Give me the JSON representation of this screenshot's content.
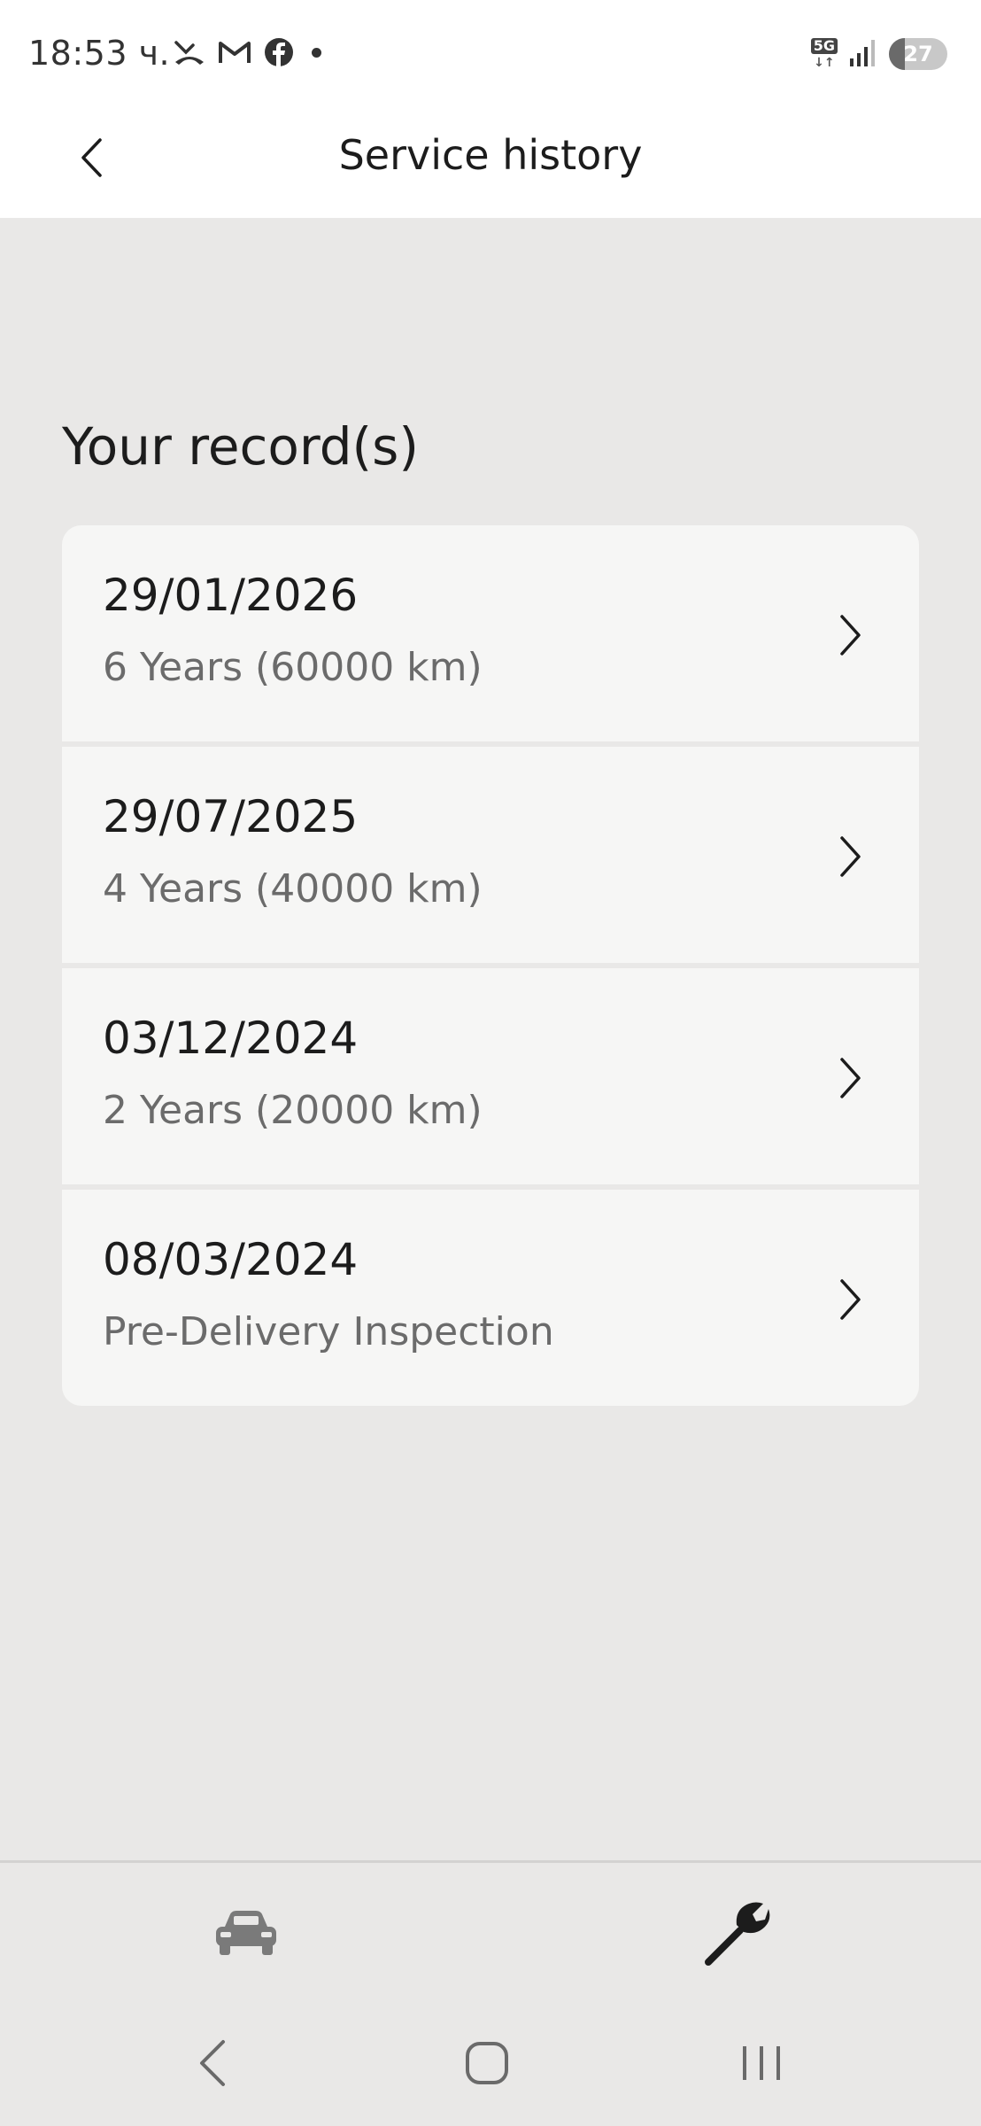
{
  "status_bar": {
    "time": "18:53 ч.",
    "network": "5G",
    "battery_level": "27",
    "battery_fraction": 0.27,
    "icons_left": [
      "missed-call-icon",
      "gmail-icon",
      "facebook-icon",
      "notification-dot"
    ],
    "icons_right": [
      "network-5g-icon",
      "signal-icon",
      "battery-icon"
    ]
  },
  "header": {
    "title": "Service history",
    "back_icon": "chevron-left-icon"
  },
  "section": {
    "title": "Your record(s)"
  },
  "records": [
    {
      "date": "29/01/2026",
      "description": "6 Years (60000 km)"
    },
    {
      "date": "29/07/2025",
      "description": "4 Years (40000 km)"
    },
    {
      "date": "03/12/2024",
      "description": "2 Years (20000 km)"
    },
    {
      "date": "08/03/2024",
      "description": "Pre-Delivery Inspection"
    }
  ],
  "bottom_nav": {
    "tabs": [
      {
        "icon": "car-icon",
        "active": false
      },
      {
        "icon": "wrench-icon",
        "active": true
      }
    ]
  },
  "system_nav": {
    "icons": [
      "back-icon",
      "home-icon",
      "recents-icon"
    ]
  },
  "colors": {
    "background": "#e9e8e7",
    "card": "#f6f6f5",
    "header": "#ffffff",
    "text_primary": "#1c1c1c",
    "text_secondary": "#6b6b6b",
    "inactive_icon": "#7a7a7a"
  }
}
